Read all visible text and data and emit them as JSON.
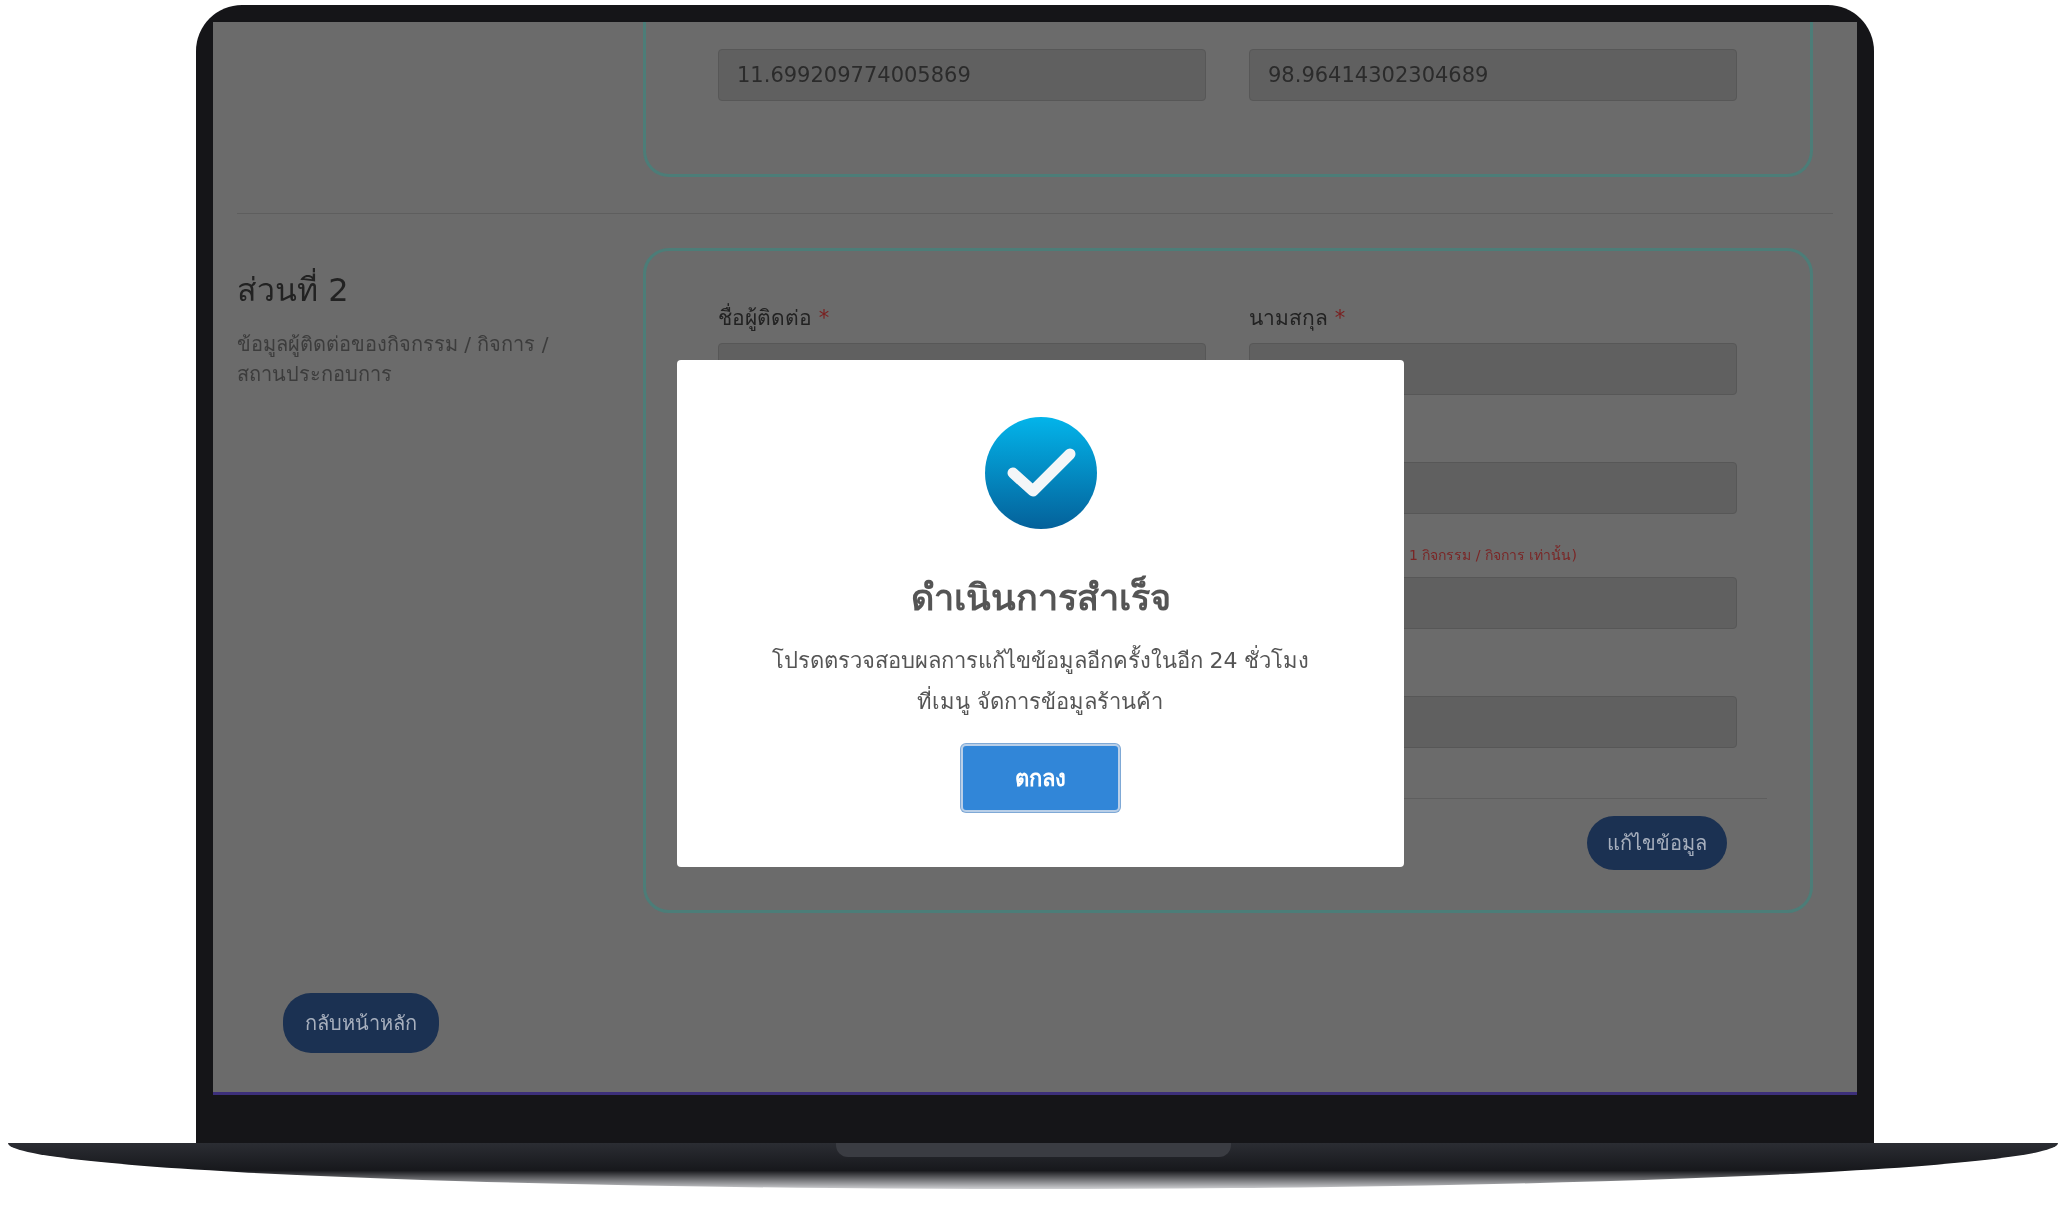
{
  "coordinates": {
    "fields": [
      {
        "value": "11.699209774005869"
      },
      {
        "value": "98.96414302304689"
      }
    ]
  },
  "section_2": {
    "title": "ส่วนที่ 2",
    "description": "ข้อมูลผู้ติดต่อของกิจกรรม / กิจการ / สถานประกอบการ",
    "fields": [
      {
        "label": "ชื่อผู้ติดต่อ",
        "required_mark": "*"
      },
      {
        "label": "นามสกุล",
        "required_mark": "*"
      }
    ],
    "note": "1 กิจกรรม / กิจการ เท่านั้น)",
    "edit_button": "แก้ไขข้อมูล"
  },
  "back_button": "กลับหน้าหลัก",
  "dialog": {
    "title": "ดำเนินการสำเร็จ",
    "message": "โปรดตรวจสอบผลการแก้ไขข้อมูลอีกครั้งในอีก 24 ชั่วโมง\nที่เมนู จัดการข้อมูลร้านค้า",
    "ok_button": "ตกลง"
  }
}
